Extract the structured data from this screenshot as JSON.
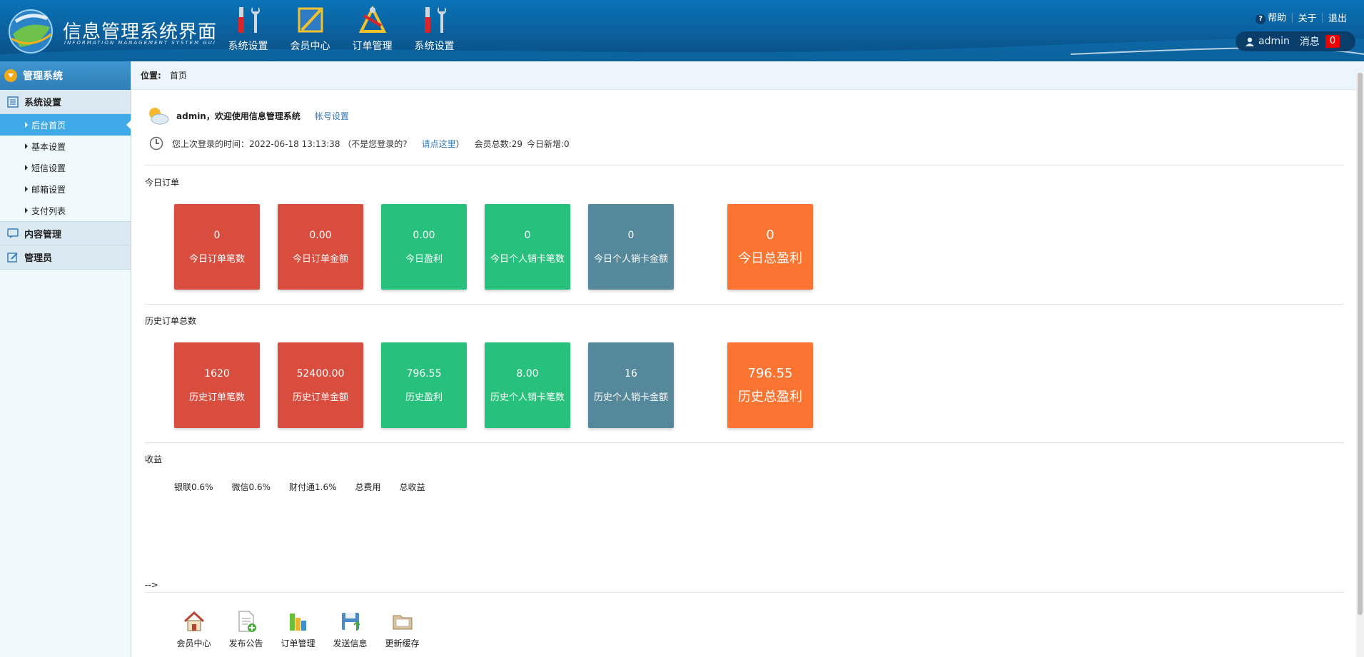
{
  "header": {
    "title": "信息管理系统界面",
    "subtitle": "INFORMATION MANAGEMENT SYSTEM GUI",
    "nav": [
      {
        "label": "系统设置",
        "icon": "tools-icon"
      },
      {
        "label": "会员中心",
        "icon": "ruler-icon"
      },
      {
        "label": "订单管理",
        "icon": "drafting-icon"
      },
      {
        "label": "系统设置",
        "icon": "tools-icon"
      }
    ],
    "links": {
      "help": "帮助",
      "about": "关于",
      "logout": "退出"
    },
    "user": {
      "name": "admin",
      "messages_label": "消息",
      "messages_count": "0"
    }
  },
  "sidebar": {
    "title": "管理系统",
    "sections": [
      {
        "label": "系统设置",
        "items": [
          "后台首页",
          "基本设置",
          "短信设置",
          "邮箱设置",
          "支付列表"
        ]
      },
      {
        "label": "内容管理"
      },
      {
        "label": "管理员"
      }
    ]
  },
  "breadcrumb": {
    "label": "位置:",
    "current": "首页"
  },
  "welcome": {
    "user": "admin，欢迎使用信息管理系统",
    "account_link": "帐号设置",
    "last_login_prefix": "您上次登录的时间：2022-06-18 13:13:38 （不是您登录的?",
    "click_here": "请点这里",
    "close_paren": "）",
    "member_total": "会员总数:29",
    "today_new": "今日新增:0"
  },
  "today": {
    "title": "今日订单",
    "cards": [
      {
        "value": "0",
        "label": "今日订单笔数"
      },
      {
        "value": "0.00",
        "label": "今日订单金额"
      },
      {
        "value": "0.00",
        "label": "今日盈利"
      },
      {
        "value": "0",
        "label": "今日个人销卡笔数"
      },
      {
        "value": "0",
        "label": "今日个人销卡金额"
      },
      {
        "value": "0",
        "label": "今日总盈利"
      }
    ]
  },
  "history": {
    "title": "历史订单总数",
    "cards": [
      {
        "value": "1620",
        "label": "历史订单笔数"
      },
      {
        "value": "52400.00",
        "label": "历史订单金额"
      },
      {
        "value": "796.55",
        "label": "历史盈利"
      },
      {
        "value": "8.00",
        "label": "历史个人销卡笔数"
      },
      {
        "value": "16",
        "label": "历史个人销卡金额"
      },
      {
        "value": "796.55",
        "label": "历史总盈利"
      }
    ]
  },
  "income": {
    "title": "收益",
    "items": [
      "银联0.6%",
      "微信0.6%",
      "财付通1.6%",
      "总费用",
      "总收益"
    ]
  },
  "stray_text": "-->",
  "quick_links": [
    {
      "label": "会员中心",
      "icon": "house-icon"
    },
    {
      "label": "发布公告",
      "icon": "document-add-icon"
    },
    {
      "label": "订单管理",
      "icon": "bar-chart-icon"
    },
    {
      "label": "发送信息",
      "icon": "floppy-send-icon"
    },
    {
      "label": "更新缓存",
      "icon": "folder-icon"
    }
  ]
}
